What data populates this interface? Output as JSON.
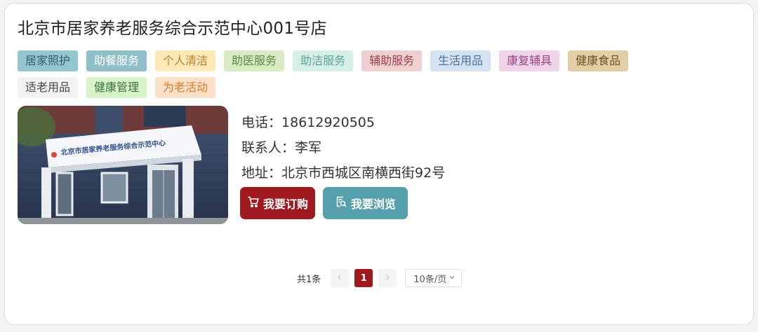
{
  "store": {
    "title": "北京市居家养老服务综合示范中心001号店",
    "sign_text": "北京市居家养老服务综合示范中心"
  },
  "tags": [
    {
      "label": "居家照护",
      "bg": "#94c6d0",
      "fg": "#2f5f6b"
    },
    {
      "label": "助餐服务",
      "bg": "#90bfc9",
      "fg": "#ffffff"
    },
    {
      "label": "个人清洁",
      "bg": "#fde9b8",
      "fg": "#b9832c"
    },
    {
      "label": "助医服务",
      "bg": "#d8ebc4",
      "fg": "#5f8a42"
    },
    {
      "label": "助洁服务",
      "bg": "#d7efe9",
      "fg": "#5aa593"
    },
    {
      "label": "辅助服务",
      "bg": "#f0cfd1",
      "fg": "#9a4148"
    },
    {
      "label": "生活用品",
      "bg": "#d4e3f2",
      "fg": "#4c6f96"
    },
    {
      "label": "康复辅具",
      "bg": "#f0d4ea",
      "fg": "#9a457f"
    },
    {
      "label": "健康食品",
      "bg": "#e3cfa7",
      "fg": "#6e5024"
    },
    {
      "label": "适老用品",
      "bg": "#f3f3f3",
      "fg": "#444444"
    },
    {
      "label": "健康管理",
      "bg": "#d7f5c9",
      "fg": "#3c6f31"
    },
    {
      "label": "为老活动",
      "bg": "#fde0c8",
      "fg": "#d97a2f"
    }
  ],
  "info": {
    "phone_label": "电话：",
    "phone": "18612920505",
    "contact_label": "联系人：",
    "contact": "李军",
    "address_label": "地址：",
    "address": "北京市西城区南横西街92号"
  },
  "actions": {
    "order_label": "我要订购",
    "browse_label": "我要浏览",
    "order_icon": "cart-icon",
    "browse_icon": "browse-icon"
  },
  "pagination": {
    "total_text": "共1条",
    "current_page": "1",
    "page_size": "10条/页",
    "prev_icon": "chevron-left-icon",
    "next_icon": "chevron-right-icon"
  },
  "colors": {
    "accent_red": "#9e1a1f",
    "accent_teal": "#56a0ad"
  }
}
